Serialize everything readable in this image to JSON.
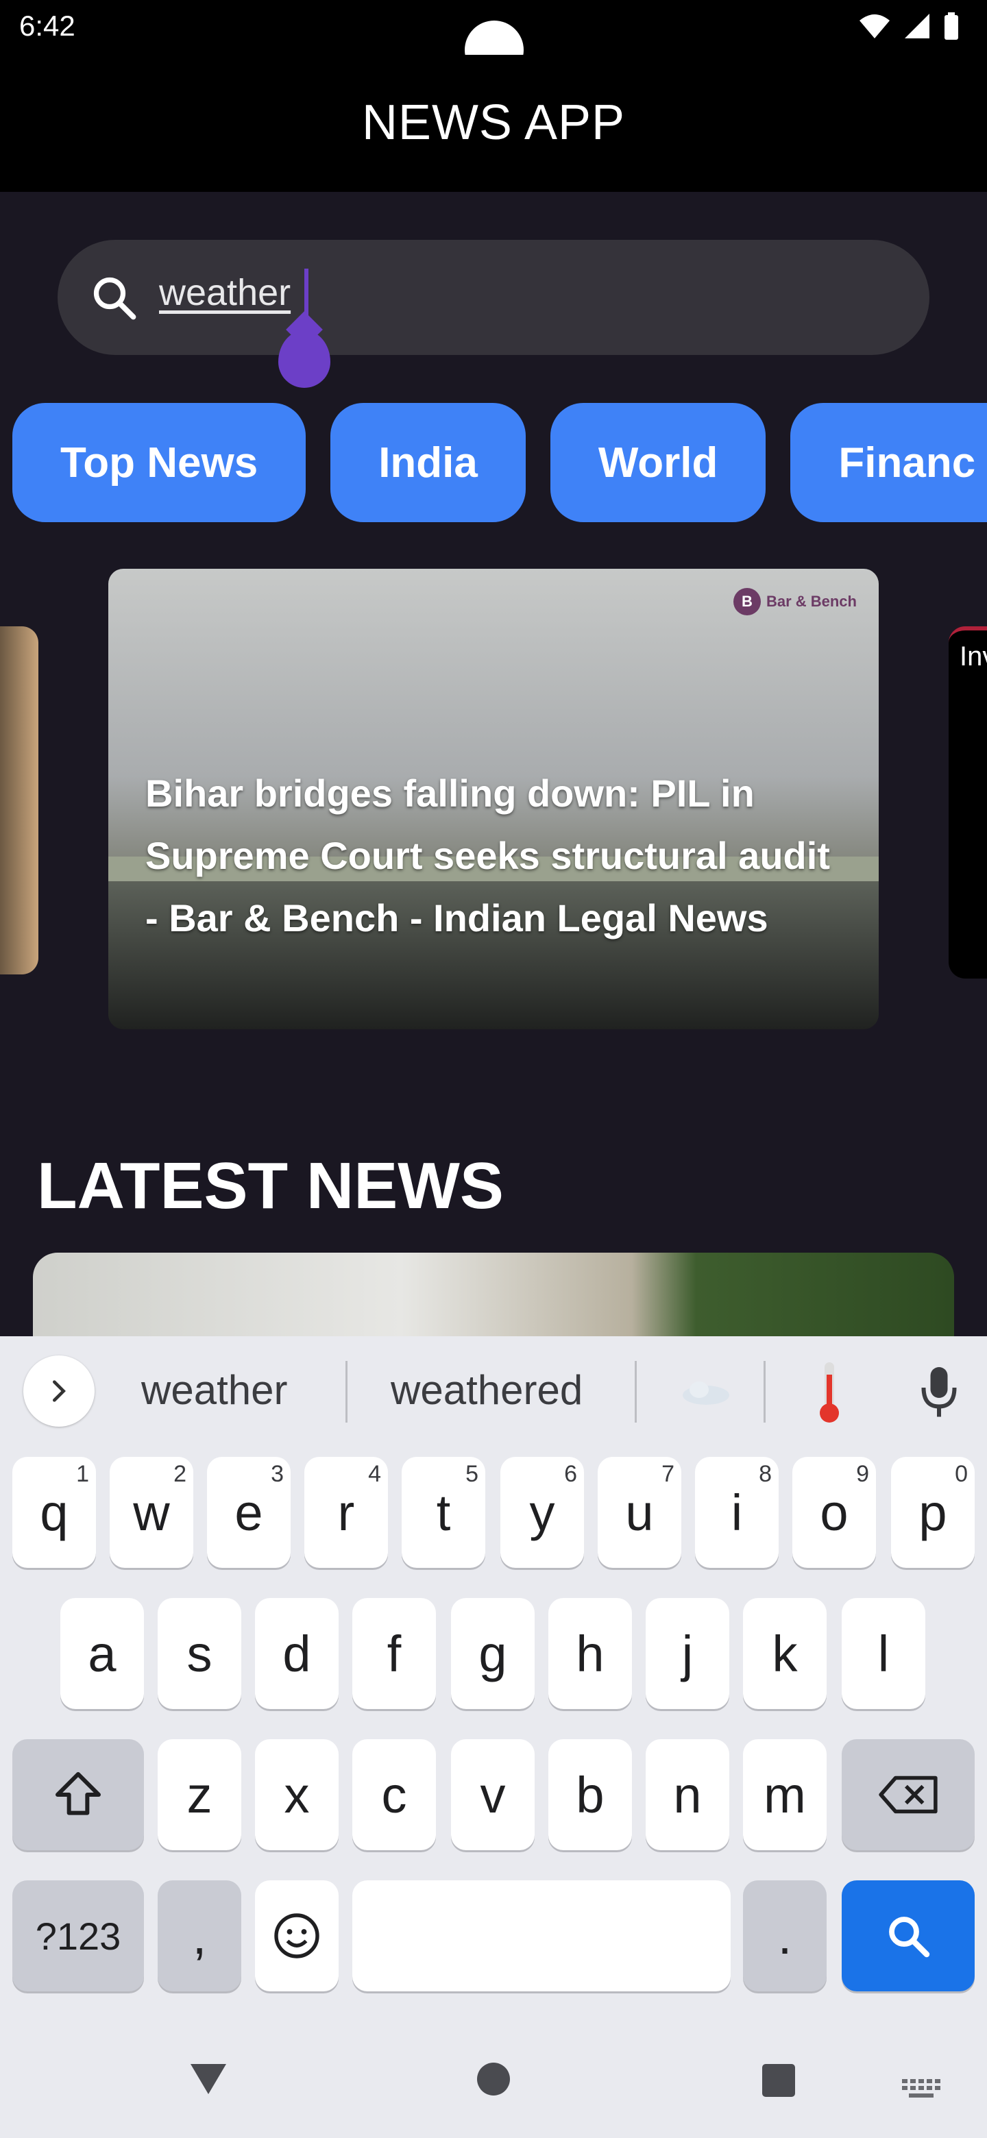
{
  "status": {
    "time": "6:42"
  },
  "app": {
    "title": "NEWS APP"
  },
  "search": {
    "value": "weather"
  },
  "categories": [
    "Top News",
    "India",
    "World",
    "Financ"
  ],
  "carousel": {
    "main_title": "Bihar bridges falling down: PIL in Supreme Court seeks structural audit - Bar & Bench - Indian Legal News",
    "logo_text": "Bar & Bench",
    "right_card_tag": "Inv"
  },
  "latest": {
    "heading": "LATEST NEWS"
  },
  "keyboard": {
    "suggestions": [
      "weather",
      "weathered"
    ],
    "row1": [
      "q",
      "w",
      "e",
      "r",
      "t",
      "y",
      "u",
      "i",
      "o",
      "p"
    ],
    "row1_hints": [
      "1",
      "2",
      "3",
      "4",
      "5",
      "6",
      "7",
      "8",
      "9",
      "0"
    ],
    "row2": [
      "a",
      "s",
      "d",
      "f",
      "g",
      "h",
      "j",
      "k",
      "l"
    ],
    "row3": [
      "z",
      "x",
      "c",
      "v",
      "b",
      "n",
      "m"
    ],
    "symbols_label": "?123",
    "comma": ",",
    "period": "."
  },
  "colors": {
    "chip": "#3f82f7",
    "cursor": "#6c3fc7",
    "search_key": "#1a73e8",
    "background": "#1a1722"
  }
}
